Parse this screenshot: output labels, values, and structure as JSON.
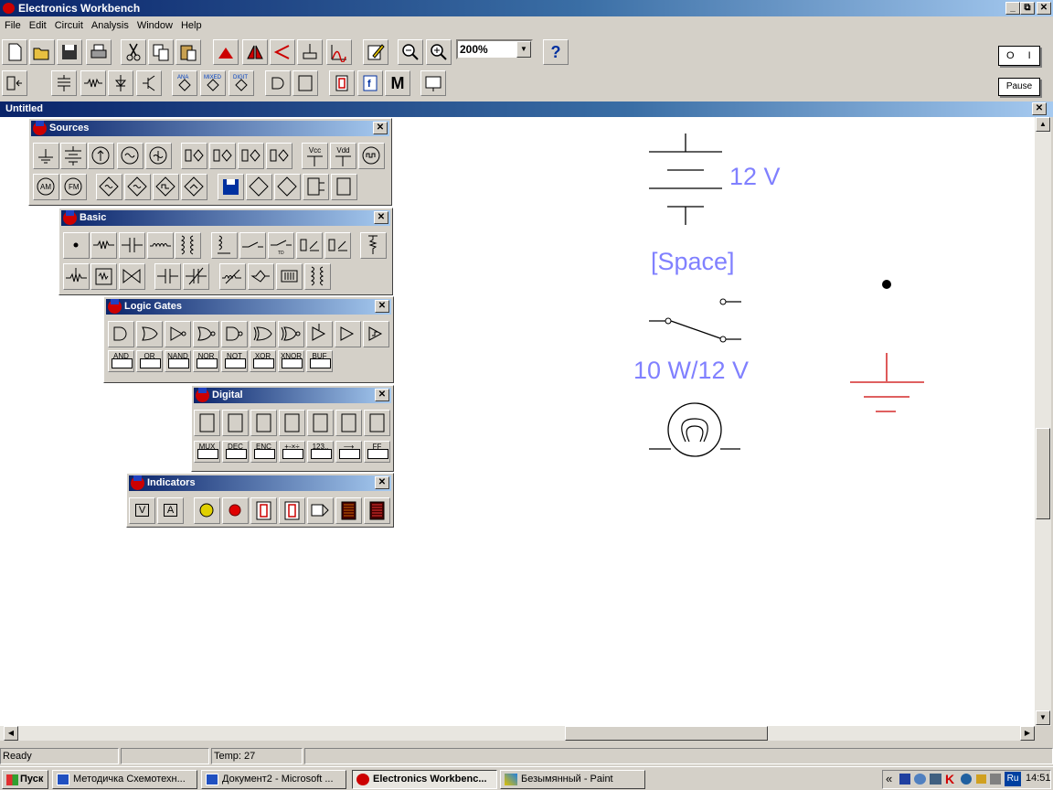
{
  "app": {
    "title": "Electronics Workbench"
  },
  "menu": [
    "File",
    "Edit",
    "Circuit",
    "Analysis",
    "Window",
    "Help"
  ],
  "toolbar": {
    "zoom": "200%",
    "help_glyph": "?"
  },
  "power": {
    "pause_label": "Pause",
    "switch_label": "O I"
  },
  "document": {
    "title": "Untitled"
  },
  "palettes": {
    "sources": {
      "title": "Sources",
      "vcc": "Vcc",
      "vdd": "Vdd",
      "am": "AM",
      "fm": "FM"
    },
    "basic": {
      "title": "Basic"
    },
    "logic": {
      "title": "Logic Gates",
      "labels": [
        "AND",
        "OR",
        "NAND",
        "NOR",
        "NOT",
        "XOR",
        "XNOR",
        "BUF"
      ]
    },
    "digital": {
      "title": "Digital",
      "labels": [
        "MUX",
        "DEC",
        "ENC",
        "+-×÷",
        "123..",
        "⟶",
        "FF"
      ]
    },
    "indicators": {
      "title": "Indicators",
      "v": "V",
      "a": "A"
    }
  },
  "schematic": {
    "battery_label": "12 V",
    "switch_label": "[Space]",
    "lamp_label": "10 W/12 V",
    "colors": {
      "label": "#8080ff",
      "ground": "#cc0000"
    }
  },
  "status": {
    "ready": "Ready",
    "temp": "Temp:  27"
  },
  "taskbar": {
    "start": "Пуск",
    "tasks": [
      "Методичка Схемотехн...",
      "Документ2 - Microsoft ...",
      "Electronics Workbenc...",
      "Безымянный - Paint"
    ],
    "lang": "Ru",
    "clock": "14:51",
    "chevron": "«"
  }
}
